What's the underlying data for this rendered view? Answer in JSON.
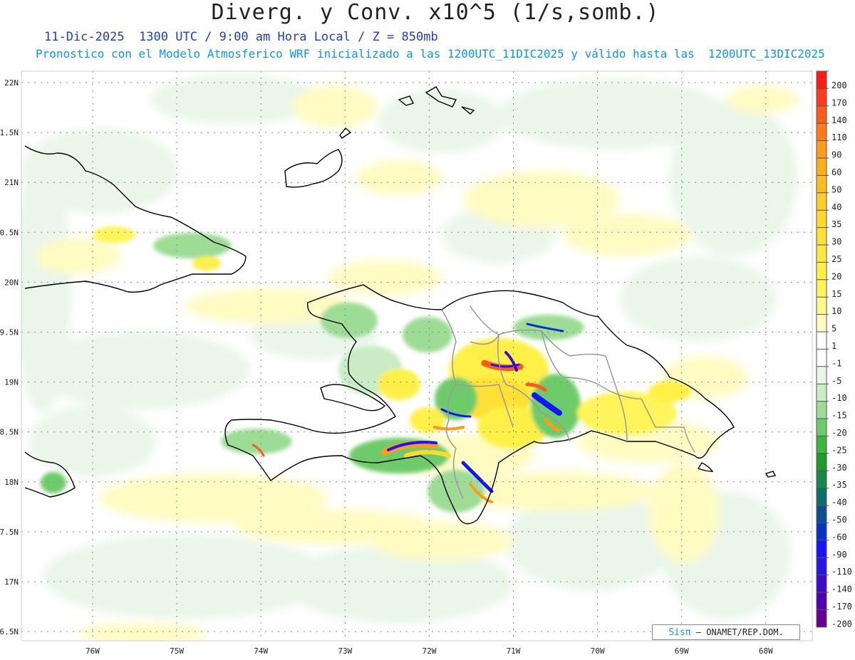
{
  "title": "Diverg. y Conv. x10^5 (1/s,somb.)",
  "subtitle": "11-Dic-2025  1300 UTC / 9:00 am Hora Local / Z = 850mb",
  "forecast_text": "Pronostico con el Modelo Atmosferico WRF inicializado a las 1200UTC_11DIC2025 y válido hasta las  1200UTC_13DIC2025",
  "credit": {
    "brand": "Sisπ",
    "org": "– ONAMET/REP.DOM."
  },
  "axes": {
    "lon_labels": [
      "76W",
      "75W",
      "74W",
      "73W",
      "72W",
      "71W",
      "70W",
      "69W",
      "68W"
    ],
    "lon_values": [
      -76,
      -75,
      -74,
      -73,
      -72,
      -71,
      -70,
      -69,
      -68
    ],
    "lat_labels": [
      "22N",
      "21.5N",
      "21N",
      "20.5N",
      "20N",
      "19.5N",
      "19N",
      "18.5N",
      "18N",
      "17.5N",
      "17N",
      "16.5N"
    ],
    "lat_values": [
      22,
      21.5,
      21,
      20.5,
      20,
      19.5,
      19,
      18.5,
      18,
      17.5,
      17,
      16.5
    ],
    "lon_range": [
      -76.8,
      -67.6
    ],
    "lat_range": [
      16.4,
      22.1
    ]
  },
  "legend": {
    "labels": [
      "200",
      "170",
      "140",
      "110",
      "90",
      "60",
      "50",
      "40",
      "35",
      "30",
      "25",
      "20",
      "15",
      "10",
      "5",
      "1",
      "-1",
      "-5",
      "-10",
      "-15",
      "-20",
      "-25",
      "-30",
      "-35",
      "-40",
      "-50",
      "-60",
      "-90",
      "-110",
      "-140",
      "-170",
      "-200"
    ],
    "colors": [
      "#ff1a1a",
      "#ff3a1a",
      "#ff5a1a",
      "#ff7a1a",
      "#ff9a1a",
      "#ffae1a",
      "#ffbe20",
      "#ffcd28",
      "#ffd92e",
      "#ffe136",
      "#ffe93e",
      "#fff046",
      "#fff55a",
      "#fff88a",
      "#fffbc2",
      "#ffffff",
      "#ffffff",
      "#eaf6ea",
      "#c9ecc6",
      "#9ddc95",
      "#6ecb69",
      "#3cb63c",
      "#1e9a2e",
      "#138a4c",
      "#0b6e6a",
      "#0a5090",
      "#0a32c8",
      "#1414ff",
      "#2814e6",
      "#3c0aca",
      "#5000b0",
      "#640096"
    ]
  },
  "colors": {
    "coast": "#000000",
    "province_borders": "#999999",
    "grid": "#888888"
  }
}
